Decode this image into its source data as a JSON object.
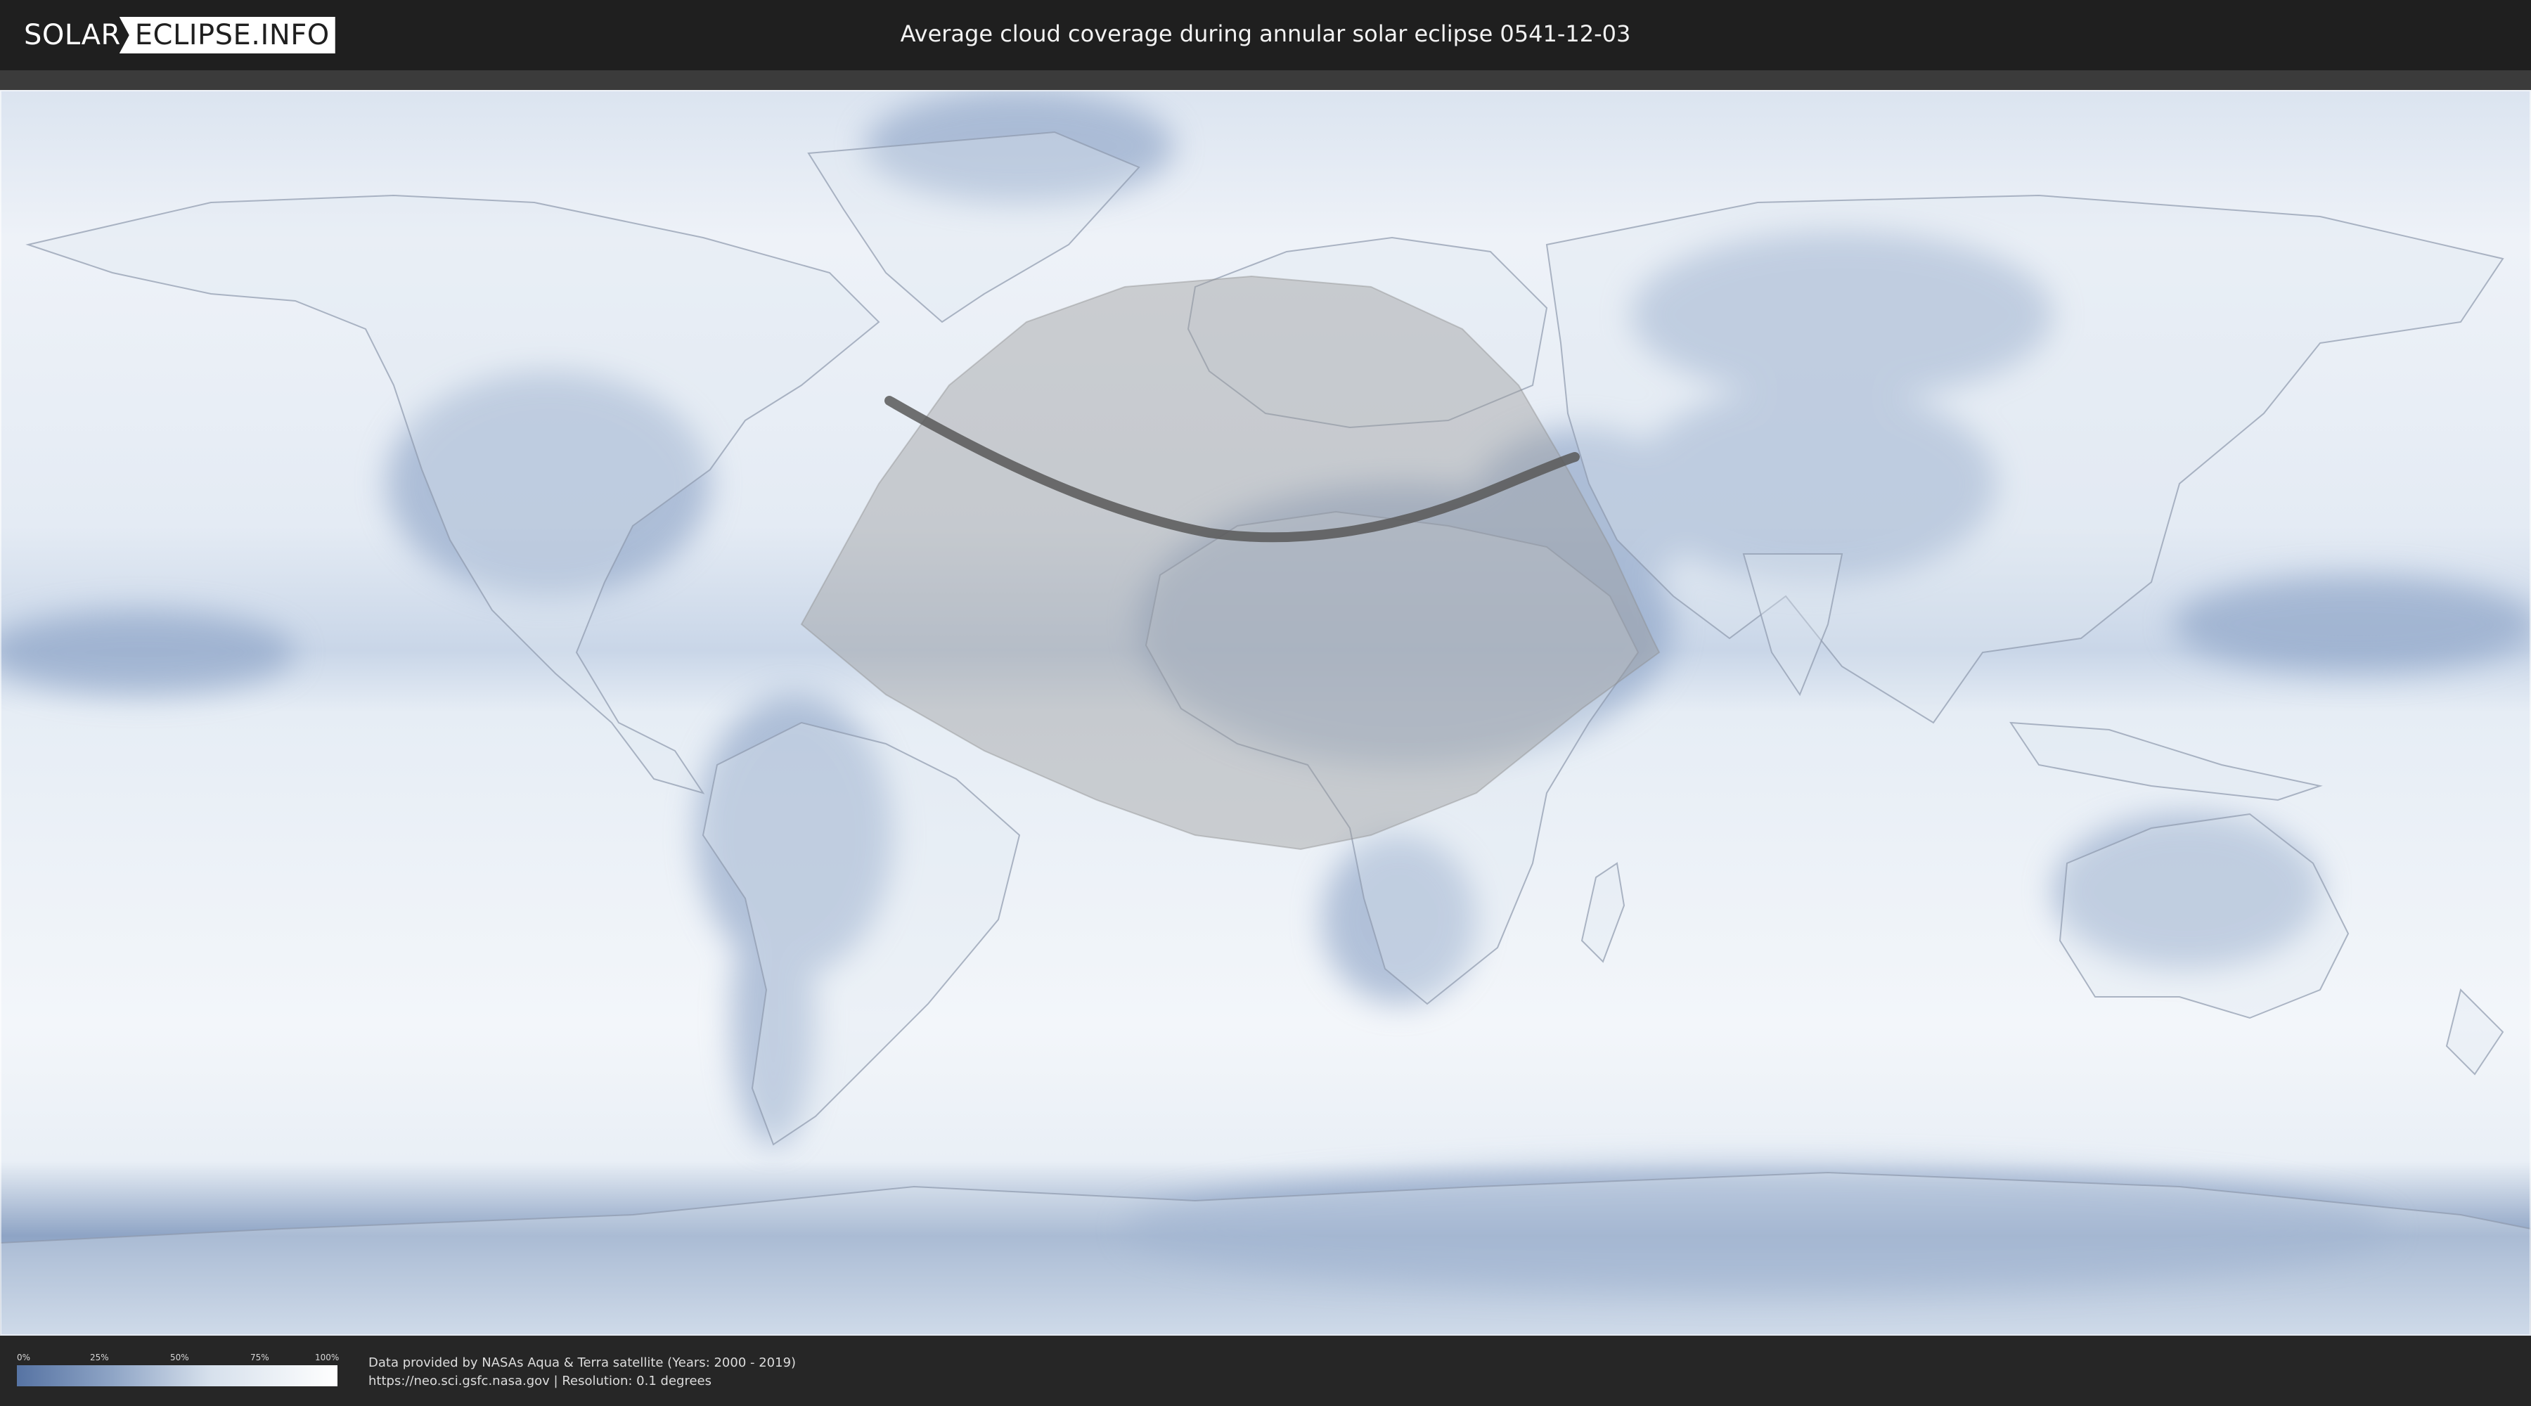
{
  "header": {
    "logo_left": "SOLAR",
    "logo_right": "ECLIPSE.INFO",
    "title": "Average cloud coverage during annular solar eclipse 0541-12-03"
  },
  "legend": {
    "ticks": [
      "0%",
      "25%",
      "50%",
      "75%",
      "100%"
    ],
    "low_color": "#5673a3",
    "high_color": "#ffffff"
  },
  "credits": {
    "line1": "Data provided by NASAs Aqua & Terra satellite (Years: 2000 - 2019)",
    "line2": "https://neo.sci.gsfc.nasa.gov | Resolution: 0.1 degrees"
  },
  "colors": {
    "background": "#1e1e1e",
    "cloud_clear": "#5673a3",
    "cloud_full": "#ffffff",
    "eclipse_zone": "#9a9a9a",
    "central_line": "#555555"
  }
}
